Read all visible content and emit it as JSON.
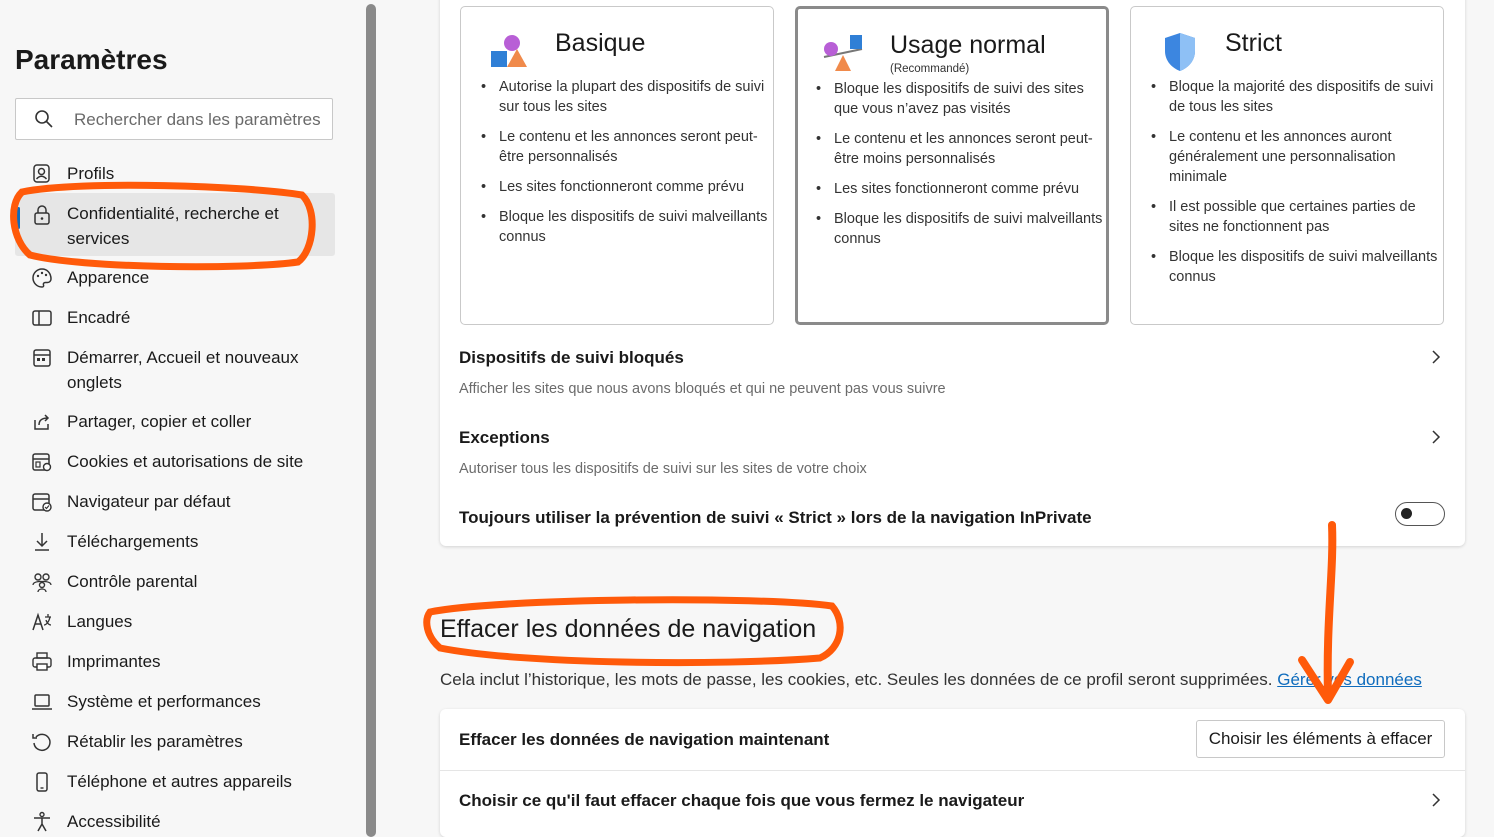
{
  "sidebar": {
    "title": "Paramètres",
    "search_placeholder": "Rechercher dans les paramètres",
    "items": [
      {
        "label": "Profils"
      },
      {
        "label": "Confidentialité, recherche et services"
      },
      {
        "label": "Apparence"
      },
      {
        "label": "Encadré"
      },
      {
        "label": "Démarrer, Accueil et nouveaux onglets"
      },
      {
        "label": "Partager, copier et coller"
      },
      {
        "label": "Cookies et autorisations de site"
      },
      {
        "label": "Navigateur par défaut"
      },
      {
        "label": "Téléchargements"
      },
      {
        "label": "Contrôle parental"
      },
      {
        "label": "Langues"
      },
      {
        "label": "Imprimantes"
      },
      {
        "label": "Système et performances"
      },
      {
        "label": "Rétablir les paramètres"
      },
      {
        "label": "Téléphone et autres appareils"
      },
      {
        "label": "Accessibilité"
      }
    ]
  },
  "tracking": {
    "cards": [
      {
        "title": "Basique",
        "subtitle": "",
        "bullets": [
          "Autorise la plupart des dispositifs de suivi sur tous les sites",
          "Le contenu et les annonces seront peut-être personnalisés",
          "Les sites fonctionneront comme prévu",
          "Bloque les dispositifs de suivi malveillants connus"
        ]
      },
      {
        "title": "Usage normal",
        "subtitle": "(Recommandé)",
        "bullets": [
          "Bloque les dispositifs de suivi des sites que vous n’avez pas visités",
          "Le contenu et les annonces seront peut-être moins personnalisés",
          "Les sites fonctionneront comme prévu",
          "Bloque les dispositifs de suivi malveillants connus"
        ]
      },
      {
        "title": "Strict",
        "subtitle": "",
        "bullets": [
          "Bloque la majorité des dispositifs de suivi de tous les sites",
          "Le contenu et les annonces auront généralement une personnalisation minimale",
          "Il est possible que certaines parties de sites ne fonctionnent pas",
          "Bloque les dispositifs de suivi malveillants connus"
        ]
      }
    ],
    "blocked_title": "Dispositifs de suivi bloqués",
    "blocked_desc": "Afficher les sites que nous avons bloqués et qui ne peuvent pas vous suivre",
    "exceptions_title": "Exceptions",
    "exceptions_desc": "Autoriser tous les dispositifs de suivi sur les sites de votre choix",
    "inprivate_label": "Toujours utiliser la prévention de suivi « Strict » lors de la navigation InPrivate",
    "inprivate_on": false
  },
  "clear": {
    "heading": "Effacer les données de navigation",
    "desc": "Cela inclut l’historique, les mots de passe, les cookies, etc. Seules les données de ce profil seront supprimées.",
    "link": "Gérer vos données",
    "now_label": "Effacer les données de navigation maintenant",
    "choose_button": "Choisir les éléments à effacer",
    "on_close_label": "Choisir ce qu'il faut effacer chaque fois que vous fermez le navigateur"
  },
  "colors": {
    "annotation": "#ff5a0a",
    "accent": "#0f6cbd"
  }
}
